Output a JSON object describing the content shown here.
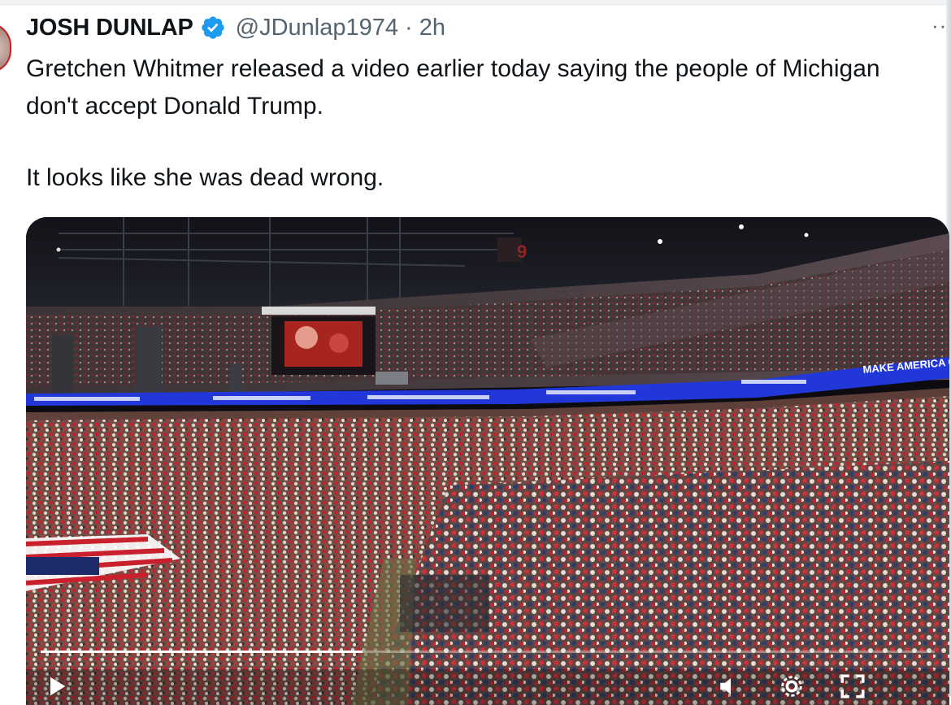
{
  "tweet": {
    "author_name": "JOSH DUNLAP",
    "handle": "@JDunlap1974",
    "separator": "·",
    "timestamp": "2h",
    "verified": true,
    "more_label": "··",
    "paragraphs": [
      "Gretchen Whitmer released a video earlier today saying the people of Michigan don't accept Donald Trump.",
      "It looks like she was dead wrong."
    ]
  },
  "media": {
    "type": "video",
    "content": "arena rally crowd",
    "progress_fraction": 0.36,
    "ribbon_text": "MAKE AMERICA GREAT AGAIN",
    "section_number": "9",
    "controls": [
      "play-icon",
      "volume-icon",
      "settings-icon",
      "fullscreen-icon"
    ]
  },
  "colors": {
    "text_primary": "#0f1419",
    "text_secondary": "#536471",
    "verified_blue": "#1d9bf0",
    "led_ribbon": "#2237d8",
    "crowd_red": "#c8202d"
  }
}
